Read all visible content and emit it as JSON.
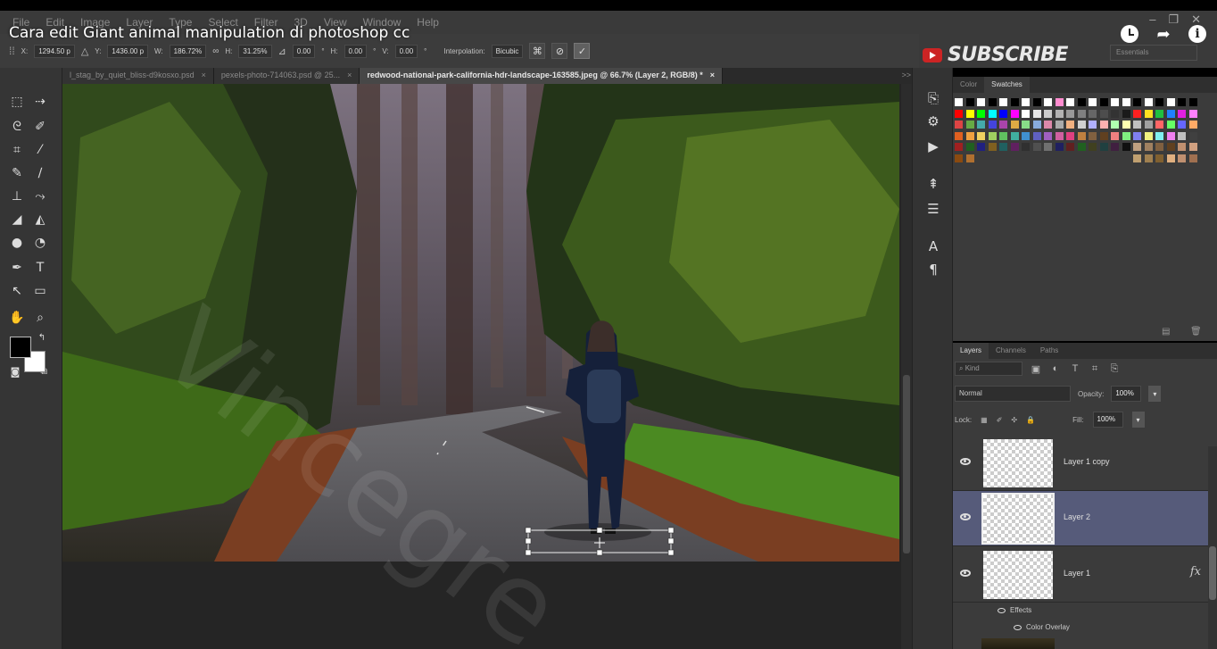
{
  "video": {
    "title": "Cara edit Giant animal manipulation di photoshop cc",
    "watch_later_icon": "clock-icon",
    "share_icon": "share-arrow-icon",
    "info_icon": "info-icon"
  },
  "menubar": {
    "items": [
      "File",
      "Edit",
      "Image",
      "Layer",
      "Type",
      "Select",
      "Filter",
      "3D",
      "View",
      "Window",
      "Help"
    ]
  },
  "options": {
    "x_label": "X:",
    "x_value": "1294.50 p",
    "y_label": "Y:",
    "y_value": "1436.00 p",
    "w_label": "W:",
    "w_value": "186.72%",
    "h_label": "H:",
    "h_value": "31.25%",
    "angle_value": "0.00",
    "hskew_label": "H:",
    "hskew_value": "0.00",
    "vskew_label": "V:",
    "vskew_value": "0.00",
    "interp_label": "Interpolation:",
    "interp_value": "Bicubic"
  },
  "subscribe": {
    "label": "SUBSCRIBE"
  },
  "workspace": {
    "label": "Essentials"
  },
  "tabs": [
    {
      "label": "l_stag_by_quiet_bliss-d9kosxo.psd",
      "close": "×"
    },
    {
      "label": "pexels-photo-714063.psd @ 25...",
      "close": "×"
    },
    {
      "label": "redwood-national-park-california-hdr-landscape-163585.jpeg @ 66.7% (Layer 2, RGB/8) *",
      "close": "×"
    }
  ],
  "tabs_overflow": ">>",
  "color_panel": {
    "tabs": [
      "Color",
      "Swatches"
    ],
    "active": "Swatches"
  },
  "layers_panel": {
    "tabs": [
      "Layers",
      "Channels",
      "Paths"
    ],
    "kind_label": "Kind",
    "blend_mode": "Normal",
    "opacity_label": "Opacity:",
    "opacity_value": "100%",
    "lock_label": "Lock:",
    "fill_label": "Fill:",
    "fill_value": "100%",
    "layers": [
      {
        "name": "Layer 1 copy",
        "selected": false
      },
      {
        "name": "Layer 2",
        "selected": true
      },
      {
        "name": "Layer 1",
        "selected": false,
        "fx": "fx"
      }
    ],
    "effects_label": "Effects",
    "effect_name": "Color Overlay"
  },
  "watermark": "Vincegre"
}
